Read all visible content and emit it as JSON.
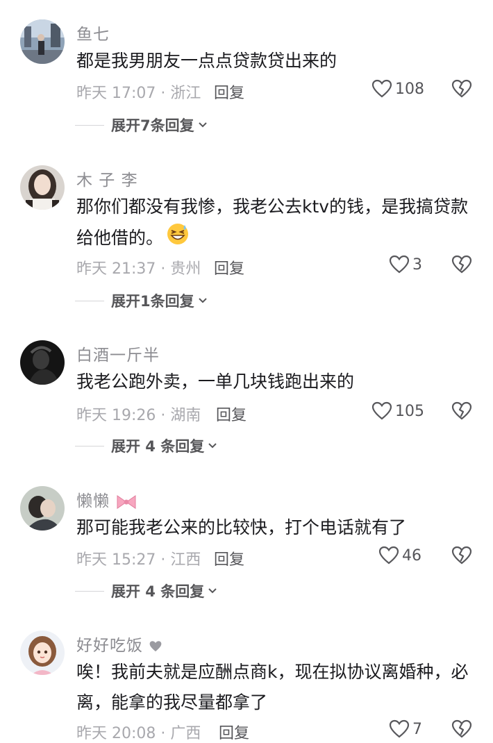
{
  "comments": [
    {
      "username": "鱼七",
      "text": "都是我男朋友一点点贷款贷出来的",
      "meta": "昨天 17:07 · 浙江",
      "reply_label": "回复",
      "likes": "108",
      "expand_label": "展开7条回复"
    },
    {
      "username": "木 子 李",
      "text": "那你们都没有我惨，我老公去ktv的钱，是我搞贷款给他借的。",
      "meta": "昨天 21:37 · 贵州",
      "reply_label": "回复",
      "likes": "3",
      "expand_label": "展开1条回复"
    },
    {
      "username": "白酒一斤半",
      "text": "我老公跑外卖，一单几块钱跑出来的",
      "meta": "昨天 19:26 · 湖南",
      "reply_label": "回复",
      "likes": "105",
      "expand_label": "展开 4 条回复"
    },
    {
      "username": "懒懒",
      "text": "那可能我老公来的比较快，打个电话就有了",
      "meta": "昨天 15:27 · 江西",
      "reply_label": "回复",
      "likes": "46",
      "expand_label": "展开 4 条回复"
    },
    {
      "username": "好好吃饭",
      "text": "唉！我前夫就是应酬点商k，现在拟协议离婚种，必离，能拿的我尽量都拿了",
      "meta": "昨天 20:08 · 广西",
      "reply_label": "回复",
      "likes": "7"
    }
  ],
  "icons": {
    "like": "heart-outline-icon",
    "dislike": "broken-heart-icon",
    "expand": "chevron-down-icon"
  },
  "colors": {
    "text": "#1b1b1f",
    "username": "#8c8c91",
    "meta": "#a8a8ad"
  }
}
